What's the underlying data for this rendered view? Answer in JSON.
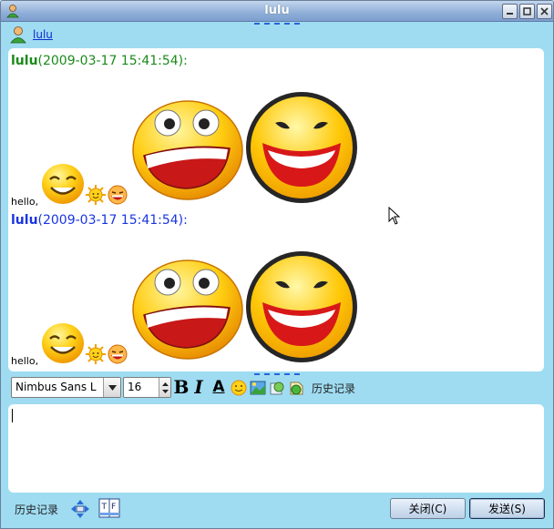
{
  "window": {
    "title": "lulu"
  },
  "contact": {
    "name": "lulu"
  },
  "messages": [
    {
      "sender": "lulu",
      "timestamp": "(2009-03-17 15:41:54):",
      "color": "#1a8a1a",
      "text": "hello,"
    },
    {
      "sender": "lulu",
      "timestamp": "(2009-03-17 15:41:54):",
      "color": "#1a35e0",
      "text": "hello,"
    }
  ],
  "toolbar": {
    "font_family": "Nimbus Sans L",
    "font_size": "16",
    "bold_label": "B",
    "italic_label": "I",
    "underline_label": "A",
    "history_label": "历史记录"
  },
  "bottom": {
    "history_label": "历史记录",
    "close_label": "关闭(C)",
    "send_label": "发送(S)"
  },
  "colors": {
    "accent": "#9fdcf2",
    "link": "#0a2cd0"
  }
}
